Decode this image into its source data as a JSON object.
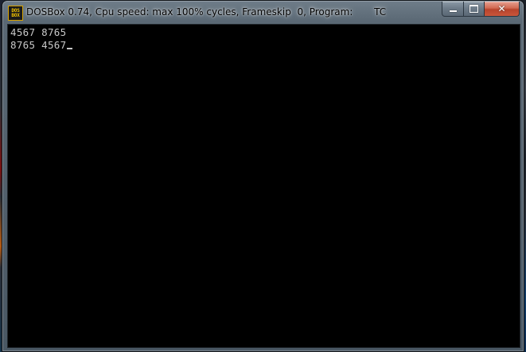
{
  "window": {
    "title": "DOSBox 0.74, Cpu speed: max 100% cycles, Frameskip  0, Program:       TC",
    "icon": {
      "name": "dosbox-icon",
      "line1": "DOS",
      "line2": "BOX"
    },
    "buttons": {
      "minimize": "minimize-icon",
      "maximize": "maximize-icon",
      "close": "close-icon",
      "close_glyph": "✕"
    }
  },
  "console": {
    "lines": [
      "4567 8765",
      "8765 4567"
    ],
    "text_color": "#c8c8c8",
    "background": "#000000"
  }
}
